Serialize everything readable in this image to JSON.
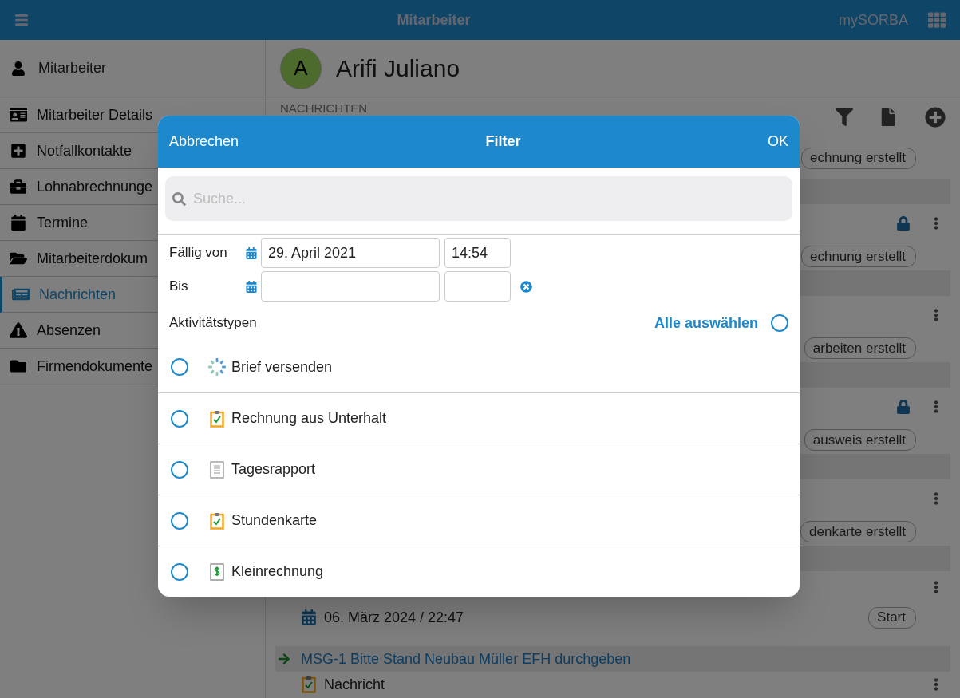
{
  "topbar": {
    "title": "Mitarbeiter",
    "brand": "mySORBA"
  },
  "sidebar": {
    "header": "Mitarbeiter",
    "items": [
      {
        "label": "Mitarbeiter Details",
        "selected": false
      },
      {
        "label": "Notfallkontakte",
        "selected": false
      },
      {
        "label": "Lohnabrechnunge",
        "selected": false
      },
      {
        "label": "Termine",
        "selected": false
      },
      {
        "label": "Mitarbeiterdokum",
        "selected": false
      },
      {
        "label": "Nachrichten",
        "selected": true
      },
      {
        "label": "Absenzen",
        "selected": false
      },
      {
        "label": "Firmendokumente",
        "selected": false
      }
    ]
  },
  "profile": {
    "initial": "A",
    "name": "Arifi Juliano"
  },
  "messages": {
    "section_label": "NACHRICHTEN",
    "cards": [
      {
        "kind": "chip-only",
        "chip": "echnung erstellt"
      },
      {
        "kind": "action",
        "locked": true,
        "chip": "echnung erstellt"
      },
      {
        "kind": "action",
        "locked": false,
        "chip": "arbeiten erstellt"
      },
      {
        "kind": "action",
        "locked": true,
        "chip": "ausweis erstellt"
      },
      {
        "kind": "action",
        "locked": false,
        "chip": "denkarte erstellt"
      },
      {
        "kind": "dated",
        "date": "06. März 2024 / 22:47",
        "chip": "Start"
      },
      {
        "kind": "titled",
        "title": "MSG-1 Bitte Stand Neubau Müller EFH durchgeben",
        "type_label": "Nachricht"
      }
    ]
  },
  "modal": {
    "cancel": "Abbrechen",
    "title": "Filter",
    "ok": "OK",
    "search_placeholder": "Suche...",
    "from_label": "Fällig von",
    "from_date": "29. April 2021",
    "from_time": "14:54",
    "to_label": "Bis",
    "types_label": "Aktivitätstypen",
    "select_all": "Alle auswählen",
    "select_all_selected": false,
    "types": [
      {
        "label": "Brief versenden",
        "kind": "dotted-circle",
        "selected": false
      },
      {
        "label": "Rechnung aus Unterhalt",
        "kind": "clipboard",
        "selected": false
      },
      {
        "label": "Tagesrapport",
        "kind": "document",
        "selected": false
      },
      {
        "label": "Stundenkarte",
        "kind": "clipboard",
        "selected": false
      },
      {
        "label": "Kleinrechnung",
        "kind": "dollar",
        "selected": false
      }
    ]
  }
}
